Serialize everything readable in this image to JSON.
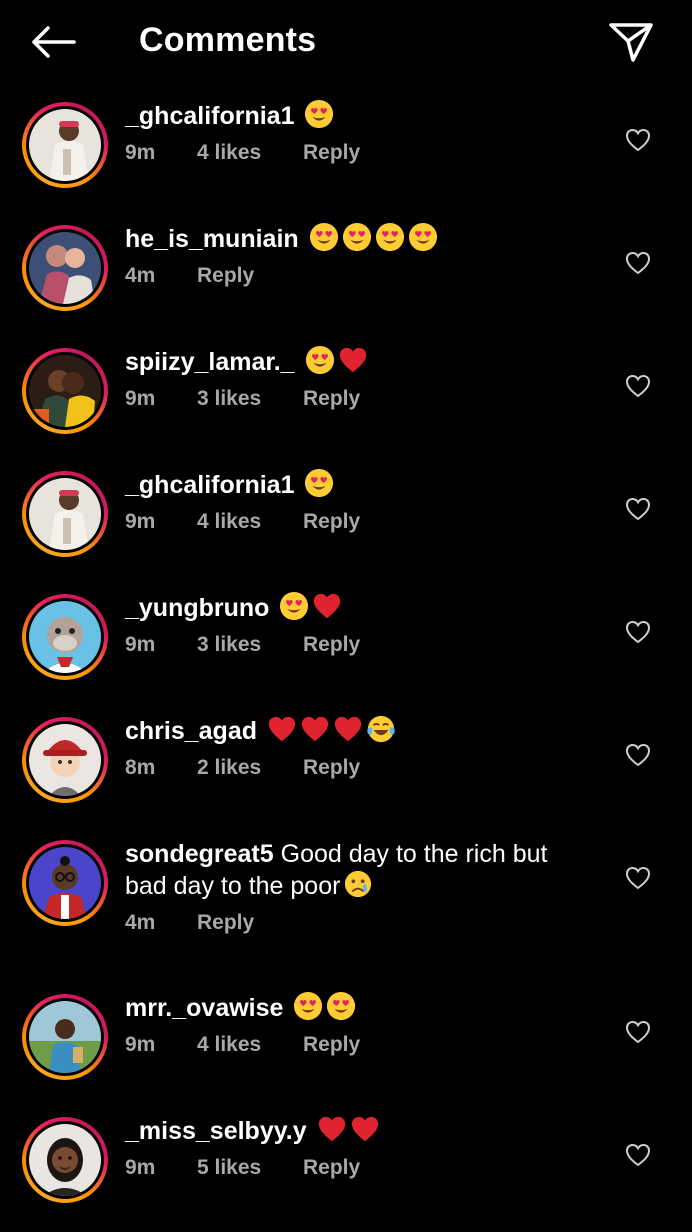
{
  "header": {
    "title": "Comments",
    "back_icon": "arrow-left-icon",
    "send_icon": "paper-plane-icon"
  },
  "colors": {
    "background": "#000000",
    "text": "#ffffff",
    "meta": "#a8a8a8",
    "ring_start": "#f9a825",
    "ring_end": "#d81b60"
  },
  "comments": [
    {
      "username": "_ghcalifornia1",
      "text": "",
      "emojis": [
        "heart-eyes"
      ],
      "time": "9m",
      "likes": "4 likes",
      "reply": "Reply",
      "avatar": "avatar-man-white-shirt"
    },
    {
      "username": "he_is_muniain",
      "text": "",
      "emojis": [
        "heart-eyes",
        "heart-eyes",
        "heart-eyes",
        "heart-eyes"
      ],
      "time": "4m",
      "likes": "",
      "reply": "Reply",
      "avatar": "avatar-couple-art"
    },
    {
      "username": "spiizy_lamar._",
      "text": "",
      "emojis": [
        "heart-eyes",
        "red-heart"
      ],
      "time": "9m",
      "likes": "3 likes",
      "reply": "Reply",
      "avatar": "avatar-couple-kissing"
    },
    {
      "username": "_ghcalifornia1",
      "text": "",
      "emojis": [
        "heart-eyes"
      ],
      "time": "9m",
      "likes": "4 likes",
      "reply": "Reply",
      "avatar": "avatar-man-white-shirt"
    },
    {
      "username": "_yungbruno",
      "text": "",
      "emojis": [
        "heart-eyes",
        "red-heart"
      ],
      "time": "9m",
      "likes": "3 likes",
      "reply": "Reply",
      "avatar": "avatar-cartoon-ape"
    },
    {
      "username": "chris_agad",
      "text": "",
      "emojis": [
        "red-heart",
        "red-heart",
        "red-heart",
        "tears-of-joy"
      ],
      "time": "8m",
      "likes": "2 likes",
      "reply": "Reply",
      "avatar": "avatar-3d-red-hat"
    },
    {
      "username": "sondegreat5",
      "text": "Good day to the rich but bad day to the poor",
      "emojis": [
        "crying-face"
      ],
      "time": "4m",
      "likes": "",
      "reply": "Reply",
      "avatar": "avatar-cartoon-blue"
    },
    {
      "username": "mrr._ovawise",
      "text": "",
      "emojis": [
        "heart-eyes",
        "heart-eyes"
      ],
      "time": "9m",
      "likes": "4 likes",
      "reply": "Reply",
      "avatar": "avatar-man-outdoor"
    },
    {
      "username": "_miss_selbyy.y",
      "text": "",
      "emojis": [
        "red-heart",
        "red-heart"
      ],
      "time": "9m",
      "likes": "5 likes",
      "reply": "Reply",
      "avatar": "avatar-woman-portrait"
    }
  ]
}
